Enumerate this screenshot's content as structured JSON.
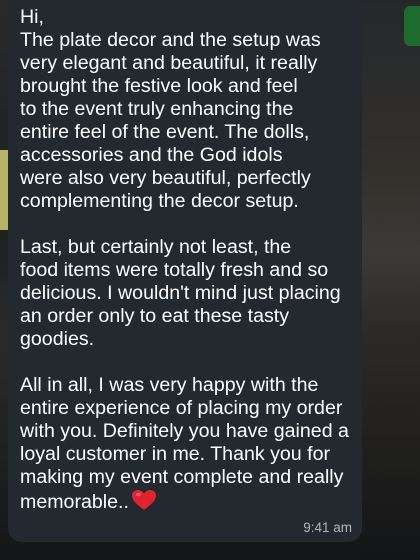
{
  "message": {
    "text": "Hi,\nThe plate decor and the setup was\nvery elegant and beautiful, it really\nbrought the festive look and feel\nto the event truly enhancing the\nentire feel of the event. The dolls,\naccessories and the God idols\nwere also very beautiful, perfectly\ncomplementing the decor setup.\n\nLast, but certainly not least, the\nfood items were totally fresh and so\ndelicious. I wouldn't mind just placing\nan order only to eat these tasty\ngoodies.\n\nAll in all, I was very happy with the\nentire experience of placing my order\nwith you. Definitely you have gained a\nloyal customer in me. Thank you for\nmaking my event complete and really\nmemorable..",
    "emoji": "red-heart-icon",
    "time": "9:41 am"
  },
  "colors": {
    "bubble": "#222a30",
    "text": "#ffffff",
    "timestamp": "#aeb6bb",
    "heart": "#e0242f"
  }
}
